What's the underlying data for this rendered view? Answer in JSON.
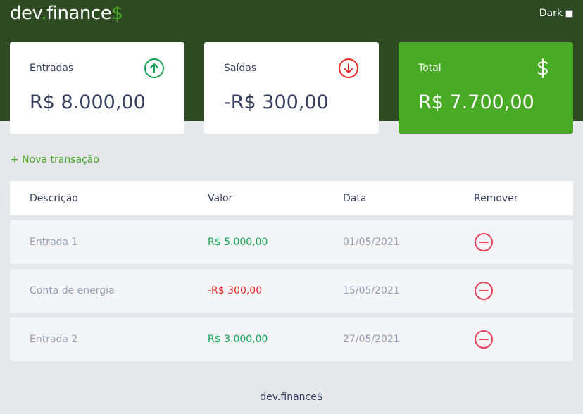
{
  "header": {
    "logo_text": "dev.finance",
    "logo_dot": ".",
    "logo_dollar": "$",
    "dark_label": "Dark"
  },
  "cards": [
    {
      "title": "Entradas",
      "value": "R$ 8.000,00",
      "icon": "arrow-up-circle-icon"
    },
    {
      "title": "Saídas",
      "value": "-R$ 300,00",
      "icon": "arrow-down-circle-icon"
    },
    {
      "title": "Total",
      "value": "R$ 7.700,00",
      "icon": "dollar-icon"
    }
  ],
  "new_transaction_label": "+ Nova transação",
  "table": {
    "headers": [
      "Descrição",
      "Valor",
      "Data",
      "Remover"
    ],
    "rows": [
      {
        "description": "Entrada 1",
        "amount": "R$ 5.000,00",
        "date": "01/05/2021",
        "type": "income"
      },
      {
        "description": "Conta de energia",
        "amount": "-R$ 300,00",
        "date": "15/05/2021",
        "type": "expense"
      },
      {
        "description": "Entrada 2",
        "amount": "R$ 3.000,00",
        "date": "27/05/2021",
        "type": "income"
      }
    ]
  },
  "footer_text": "dev.finance$",
  "colors": {
    "header_bg": "#2d4a22",
    "brand_green": "#49aa26",
    "income": "#12a454",
    "expense": "#e92929",
    "background": "#e6e7eb"
  }
}
